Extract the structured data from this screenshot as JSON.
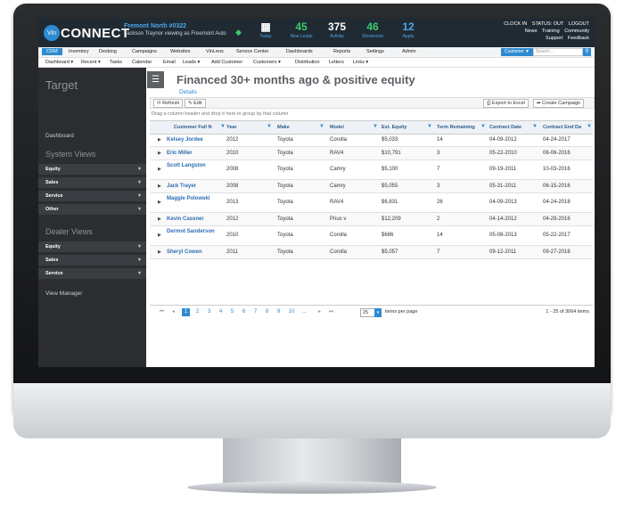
{
  "app": {
    "logo_badge": "Vin",
    "logo_text": "CONNECT",
    "dealer_name": "Fremont North #0322",
    "user_line": "Jackson Traynor viewing as Freemont Auto"
  },
  "stats": [
    {
      "num": "",
      "label": "Today"
    },
    {
      "num": "45",
      "label": "New Leads"
    },
    {
      "num": "375",
      "label": "Activity"
    },
    {
      "num": "46",
      "label": "Showroom"
    },
    {
      "num": "12",
      "label": "Appts"
    }
  ],
  "toplinks": {
    "row1": [
      "CLOCK IN",
      "STATUS: OUT",
      "LOGOUT"
    ],
    "row2": [
      "News",
      "Training",
      "Community"
    ],
    "row3": [
      "Support",
      "Feedback"
    ]
  },
  "nav1": [
    "CRM",
    "Inventory",
    "Desking",
    "Campaigns",
    "Websites",
    "VinLens",
    "Service Center",
    "Dashboards",
    "Reports",
    "Settings",
    "Admin"
  ],
  "nav_search": {
    "scope": "Customer ▼",
    "placeholder": "Search..."
  },
  "nav2": [
    "Dashboard ▾",
    "Recent ▾",
    "Tasks",
    "Calendar",
    "Email",
    "Leads ▾",
    "Add Customer",
    "Customers ▾",
    "Distribution",
    "Letters",
    "Links ▾"
  ],
  "sidebar": {
    "title": "Target",
    "dashboard": "Dashboard",
    "system_views": "System Views",
    "system_items": [
      "Equity",
      "Sales",
      "Service",
      "Other"
    ],
    "dealer_views": "Dealer Views",
    "dealer_items": [
      "Equity",
      "Sales",
      "Service"
    ],
    "view_manager": "View Manager"
  },
  "main": {
    "title": "Financed 30+ months ago & positive equity",
    "details": "Details",
    "refresh": "⟳ Refresh",
    "edit": "✎ Edit",
    "export": "⎙ Export to Excel",
    "campaign": "➦ Create Campaign",
    "group_hint": "Drag a column header and drop it here to group by that column"
  },
  "columns": [
    "Customer Full N",
    "Year",
    "Make",
    "Model",
    "Est. Equity",
    "Term Remaining",
    "Contract Date",
    "Contract End Da"
  ],
  "rows": [
    {
      "name": "Kelsey Jordee",
      "year": "2012",
      "make": "Toyota",
      "model": "Corolla",
      "equity": "$5,033",
      "term": "14",
      "start": "04-09-2012",
      "end": "04-24-2017"
    },
    {
      "name": "Eric Miller",
      "year": "2010",
      "make": "Toyota",
      "model": "RAV4",
      "equity": "$10,791",
      "term": "3",
      "start": "05-22-2010",
      "end": "06-06-2016"
    },
    {
      "name": "Scott Langston",
      "year": "2008",
      "make": "Toyota",
      "model": "Camry",
      "equity": "$5,100",
      "term": "7",
      "start": "09-19-2011",
      "end": "10-03-2016"
    },
    {
      "name": "Jack Trayer",
      "year": "2008",
      "make": "Toyota",
      "model": "Camry",
      "equity": "$5,055",
      "term": "3",
      "start": "05-31-2011",
      "end": "06-15-2016"
    },
    {
      "name": "Maggie Polowski",
      "year": "2013",
      "make": "Toyota",
      "model": "RAV4",
      "equity": "$6,831",
      "term": "26",
      "start": "04-09-2013",
      "end": "04-24-2018"
    },
    {
      "name": "Kevin Cassner",
      "year": "2012",
      "make": "Toyota",
      "model": "Prius v",
      "equity": "$12,209",
      "term": "2",
      "start": "04-14-2012",
      "end": "04-29-2016"
    },
    {
      "name": "Dermot Sanderson",
      "year": "2010",
      "make": "Toyota",
      "model": "Corolla",
      "equity": "$686",
      "term": "14",
      "start": "05-08-2013",
      "end": "05-22-2017"
    },
    {
      "name": "Sheryl Cowen",
      "year": "2011",
      "make": "Toyota",
      "model": "Corolla",
      "equity": "$5,057",
      "term": "7",
      "start": "09-12-2011",
      "end": "09-27-2016"
    }
  ],
  "pager": {
    "first": "⏮",
    "prev": "◂",
    "pages": [
      "1",
      "2",
      "3",
      "4",
      "5",
      "6",
      "7",
      "8",
      "9",
      "10",
      "..."
    ],
    "next": "▸",
    "last": "⏭",
    "page_size": "25",
    "items_per_page": "items per page",
    "total": "1 - 25 of 3064 items"
  }
}
